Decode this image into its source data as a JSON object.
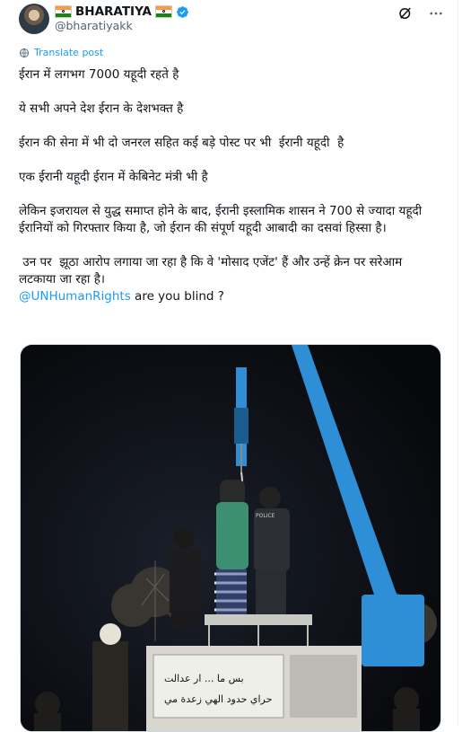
{
  "author": {
    "name": "BHARATIYA",
    "handle": "@bharatiyakk",
    "flag_glyph": "🇮🇳",
    "verified_color": "#1d9bf0"
  },
  "translate_label": "Translate post",
  "post_paragraphs": [
    "ईरान में लगभग 7000 यहूदी रहते है",
    "ये सभी अपने देश ईरान के देशभक्त है",
    "ईरान की सेना में भी दो जनरल सहित कई बड़े पोस्ट पर भी  ईरानी यहूदी  है",
    "एक ईरानी यहूदी ईरान में केबिनेट मंत्री भी है",
    "लेकिन इजरायल से युद्ध समाप्त होने के बाद, ईरानी इस्लामिक शासन ने 700 से ज्यादा यहूदी ईरानियों को गिरफ्तार किया है, जो ईरान की संपूर्ण यहूदी आबादी का दसवां हिस्सा है।",
    " उन पर  झूठा आरोप लगाया जा रहा है कि वे 'मोसाद एजेंट' हैं और उन्हें क्रेन पर सरेआम लटकाया जा रहा है।"
  ],
  "mention": "@UNHumanRights",
  "mention_suffix": " are you blind ?",
  "media": {
    "officer_vest_text": "POLICE",
    "banner_text_line1": "بس ما ... ار عدالت",
    "banner_text_line2": "حراي حدود الهي زعدة مي"
  },
  "icons": [
    "grok-icon",
    "more-icon",
    "translate-icon",
    "verified-icon"
  ],
  "colors": {
    "accent": "#1d9bf0",
    "text": "#0f1419",
    "secondary": "#536471",
    "crane": "#2f8fd6"
  }
}
